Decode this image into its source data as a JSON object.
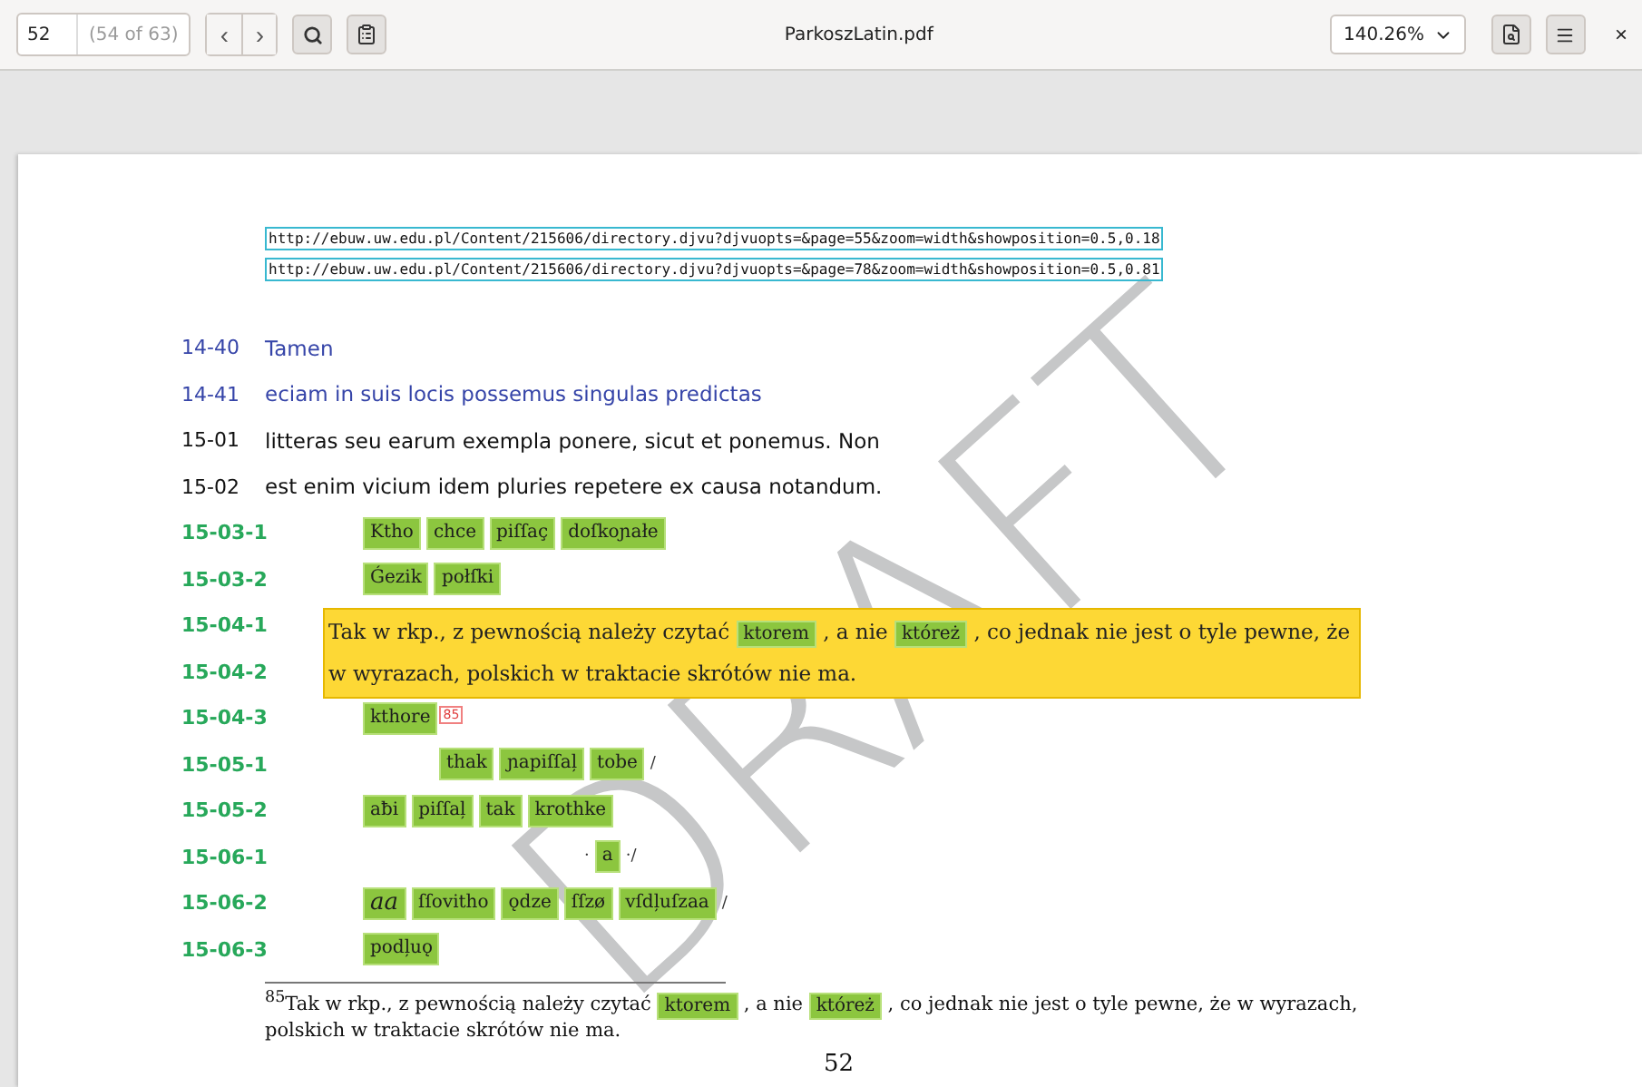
{
  "toolbar": {
    "page_input": "52",
    "page_count": "(54 of 63)",
    "prev": "‹",
    "next": "›",
    "title": "ParkoszLatin.pdf",
    "zoom": "140.26%",
    "close": "×"
  },
  "links": [
    "http://ebuw.uw.edu.pl/Content/215606/directory.djvu?djvuopts=&page=55&zoom=width&showposition=0.5,0.18",
    "http://ebuw.uw.edu.pl/Content/215606/directory.djvu?djvuopts=&page=78&zoom=width&showposition=0.5,0.81"
  ],
  "lines": [
    {
      "label": "14-40",
      "kind": "text",
      "color": "#3544a8",
      "text": "Tamen"
    },
    {
      "label": "14-41",
      "kind": "text",
      "color": "#3544a8",
      "text": "eciam in suis locis possemus singulas predictas"
    },
    {
      "label": "15-01",
      "kind": "text",
      "color": "#111111",
      "text": "litteras seu earum exempla ponere, sicut et ponemus. Non"
    },
    {
      "label": "15-02",
      "kind": "text",
      "color": "#111111",
      "text": "est enim vicium idem pluries repetere ex causa notandum."
    },
    {
      "label": "15-03-1",
      "kind": "tokens",
      "tokens": [
        {
          "kind": "word",
          "text": "Ktho"
        },
        {
          "kind": "word",
          "text": "chce"
        },
        {
          "kind": "word",
          "text": "piſſaç"
        },
        {
          "kind": "word",
          "text": "doſkoɲałe"
        }
      ]
    },
    {
      "label": "15-03-2",
      "kind": "tokens",
      "tokens": [
        {
          "kind": "word",
          "text": "Ǵezik"
        },
        {
          "kind": "word",
          "text": "połſki"
        }
      ]
    },
    {
      "label": "15-04-1",
      "kind": "tokens"
    },
    {
      "label": "15-04-2",
      "kind": "tokens"
    },
    {
      "label": "15-04-3",
      "kind": "tokens",
      "tokens": [
        {
          "kind": "word",
          "text": "kthore"
        },
        {
          "kind": "note",
          "text": "85"
        }
      ]
    },
    {
      "label": "15-05-1",
      "kind": "tokens-shifted",
      "tokens": [
        {
          "kind": "word",
          "text": "thak"
        },
        {
          "kind": "word",
          "text": "ɲapiſſal̦"
        },
        {
          "kind": "word",
          "text": "tobe"
        },
        {
          "kind": "mark",
          "text": "/"
        }
      ]
    },
    {
      "label": "15-05-2",
      "kind": "tokens",
      "tokens": [
        {
          "kind": "word",
          "text": "aƀi"
        },
        {
          "kind": "word",
          "text": "piſſal̦"
        },
        {
          "kind": "word",
          "text": "tak"
        },
        {
          "kind": "word",
          "text": "krothke"
        }
      ]
    },
    {
      "label": "15-06-1",
      "kind": "tokens-far",
      "tokens": [
        {
          "kind": "mark",
          "text": "·"
        },
        {
          "kind": "word",
          "text": "a"
        },
        {
          "kind": "mark",
          "text": "·/"
        }
      ]
    },
    {
      "label": "15-06-2",
      "kind": "tokens",
      "tokens": [
        {
          "kind": "big",
          "text": "aa"
        },
        {
          "kind": "word",
          "text": "ſſovitho"
        },
        {
          "kind": "word",
          "text": "ǫdze"
        },
        {
          "kind": "word",
          "text": "ſſzø"
        },
        {
          "kind": "word",
          "text": "vſdl̦uſzaa"
        },
        {
          "kind": "mark",
          "text": "/"
        }
      ]
    },
    {
      "label": "15-06-3",
      "kind": "tokens",
      "tokens": [
        {
          "kind": "word",
          "text": "podl̦uǫ"
        }
      ]
    }
  ],
  "popup": [
    {
      "kind": "text",
      "text": "Tak w rkp., z pewnością należy czytać"
    },
    {
      "kind": "word",
      "text": "ktorem"
    },
    {
      "kind": "text",
      "text": ", a nie"
    },
    {
      "kind": "word",
      "text": "któreż"
    },
    {
      "kind": "text",
      "text": ", co jednak nie jest o tyle pewne, że w wyrazach, polskich w traktacie skrótów nie ma."
    }
  ],
  "footnote": {
    "mark": "85",
    "parts": [
      {
        "kind": "text",
        "text": "Tak w rkp., z pewnością należy czytać"
      },
      {
        "kind": "word",
        "text": "ktorem"
      },
      {
        "kind": "text",
        "text": ", a nie"
      },
      {
        "kind": "word",
        "text": "któreż"
      },
      {
        "kind": "text",
        "text": ", co jednak nie jest o tyle pewne, że w wyrazach, polskich w traktacie skrótów nie ma."
      }
    ]
  },
  "page_number": "52",
  "watermark": "DRAFT"
}
